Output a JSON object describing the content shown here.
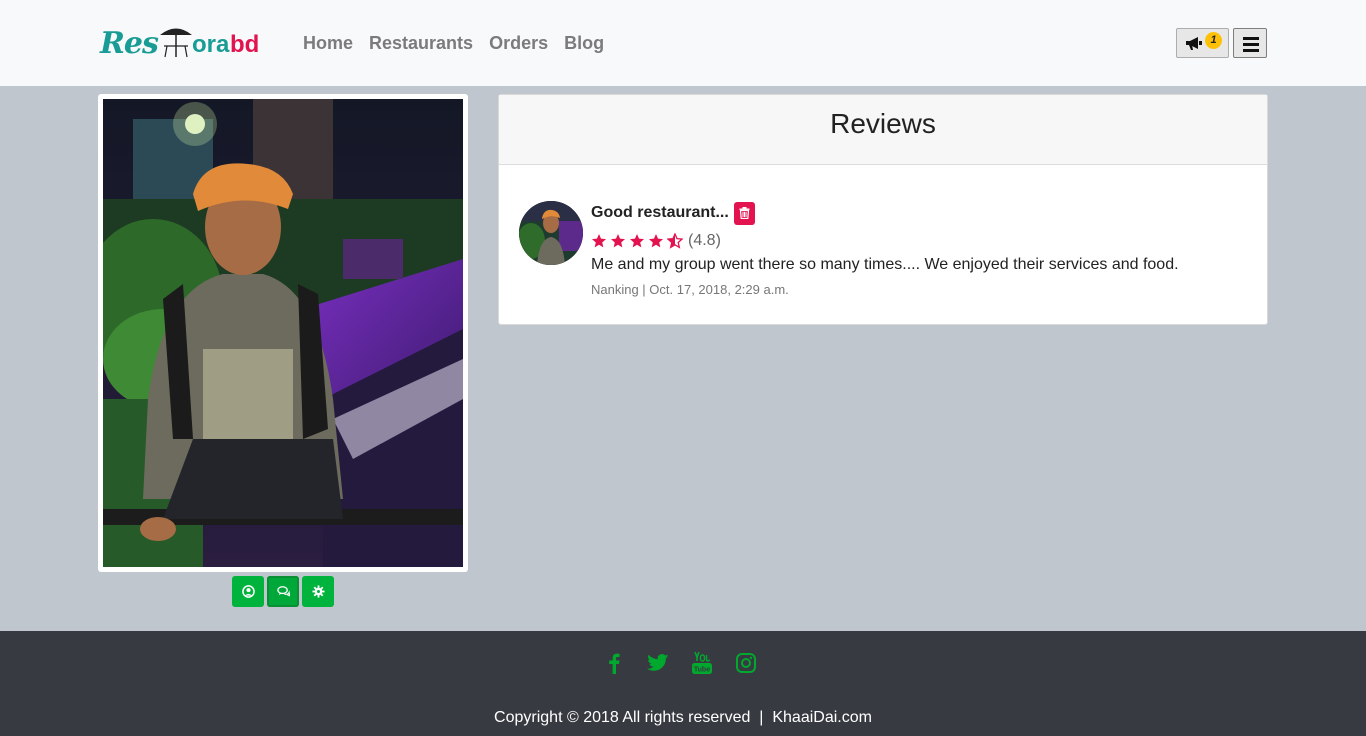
{
  "brand": {
    "logo_text_left": "Res",
    "logo_text_mid": "ora",
    "logo_text_right": "bd"
  },
  "nav": {
    "links": [
      {
        "label": "Home"
      },
      {
        "label": "Restaurants"
      },
      {
        "label": "Orders"
      },
      {
        "label": "Blog"
      }
    ],
    "notification_icon": "megaphone-icon",
    "notification_count": "1",
    "menu_icon": "hamburger-icon"
  },
  "profile": {
    "actions": [
      {
        "name": "profile-button",
        "icon": "user-circle-icon"
      },
      {
        "name": "reviews-button",
        "icon": "comments-icon",
        "active": true
      },
      {
        "name": "settings-button",
        "icon": "gear-icon"
      }
    ],
    "action_color": "#00b33c"
  },
  "reviews": {
    "heading": "Reviews",
    "items": [
      {
        "title": "Good restaurant...",
        "rating_text": "(4.8)",
        "rating_value": 4.8,
        "text": "Me and my group went there so many times.... We enjoyed their services and food.",
        "meta": "Nanking | Oct. 17, 2018, 2:29 a.m.",
        "delete_icon": "trash-icon"
      }
    ],
    "star_color": "#e2134f"
  },
  "footer": {
    "social": [
      "facebook-icon",
      "twitter-icon",
      "youtube-icon",
      "instagram-icon"
    ],
    "social_color": "#00a82d",
    "copyright": "Copyright © 2018 All rights reserved  |  KhaaiDai.com"
  }
}
